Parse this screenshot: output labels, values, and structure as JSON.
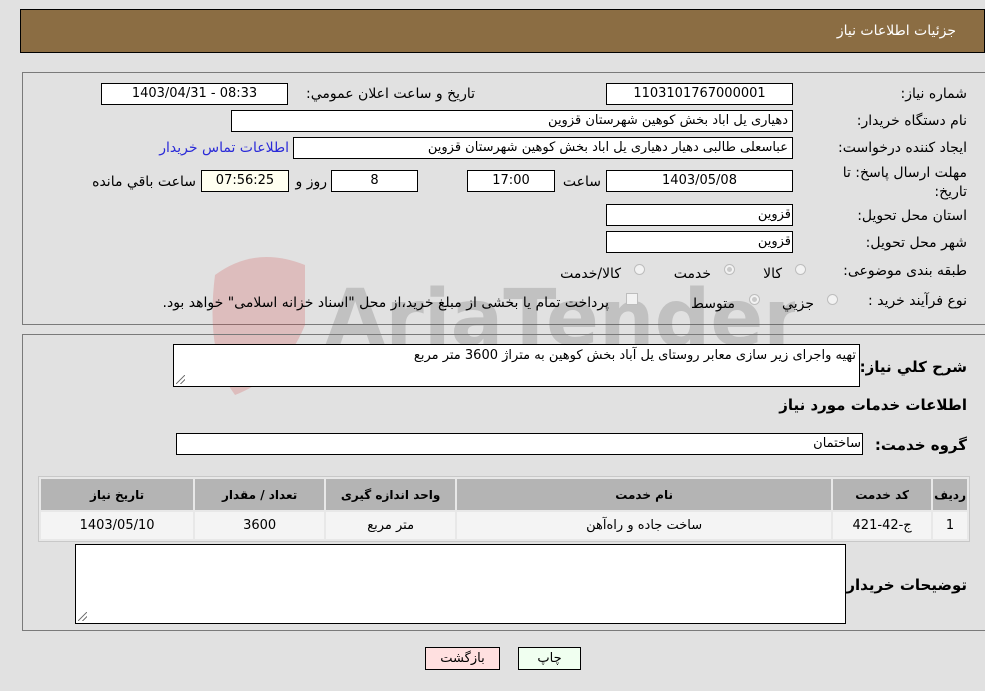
{
  "header": {
    "title": "جزئیات اطلاعات نیاز"
  },
  "form": {
    "need_number": {
      "label": "شماره نیاز:",
      "value": "1103101767000001"
    },
    "announce_datetime": {
      "label": "تاریخ و ساعت اعلان عمومي:",
      "value": "1403/04/31 - 08:33"
    },
    "buyer_org": {
      "label": "نام دستگاه خریدار:",
      "value": "دهیاری یل اباد بخش کوهین شهرستان قزوین"
    },
    "requester": {
      "label": "ایجاد کننده درخواست:",
      "value": "عباسعلی طالبی دهیار دهیاری یل اباد بخش کوهین شهرستان قزوین"
    },
    "buyer_contact_link": "اطلاعات تماس خریدار",
    "deadline": {
      "label": "مهلت ارسال پاسخ: تا تاریخ:",
      "date": "1403/05/08",
      "time_label": "ساعت",
      "time": "17:00",
      "days": "8",
      "days_label": "روز و",
      "remaining": "07:56:25",
      "remaining_label": "ساعت باقي مانده"
    },
    "province": {
      "label": "استان محل تحویل:",
      "value": "قزوین"
    },
    "city": {
      "label": "شهر محل تحویل:",
      "value": "قزوین"
    },
    "category": {
      "label": "طبقه بندی موضوعی:",
      "options": [
        "کالا",
        "خدمت",
        "کالا/خدمت"
      ],
      "selected": "خدمت"
    },
    "purchase_type": {
      "label": "نوع فرآیند خرید :",
      "options": [
        "جزيي",
        "متوسط"
      ],
      "selected": "متوسط",
      "treasury_note": "پرداخت تمام یا بخشی از مبلغ خرید،از محل \"اسناد خزانه اسلامی\" خواهد بود."
    }
  },
  "description": {
    "label": "شرح کلي نیاز:",
    "value": "تهیه واجرای زیر سازی معابر روستای یل آباد بخش کوهین به متراژ 3600 متر مربع"
  },
  "services": {
    "section_title": "اطلاعات خدمات مورد نیاز",
    "group_label": "گروه خدمت:",
    "group_value": "ساختمان",
    "table": {
      "headers": [
        "ردیف",
        "کد خدمت",
        "نام خدمت",
        "واحد اندازه گیری",
        "تعداد / مقدار",
        "تاریخ نیاز"
      ],
      "rows": [
        [
          "1",
          "ج-42-421",
          "ساخت جاده و راه‌آهن",
          "متر مربع",
          "3600",
          "1403/05/10"
        ]
      ]
    }
  },
  "buyer_notes": {
    "label": "توضیحات خریدار:",
    "value": ""
  },
  "buttons": {
    "print": "چاپ",
    "back": "بازگشت"
  },
  "watermark": {
    "text": "AriaTender.neT"
  }
}
